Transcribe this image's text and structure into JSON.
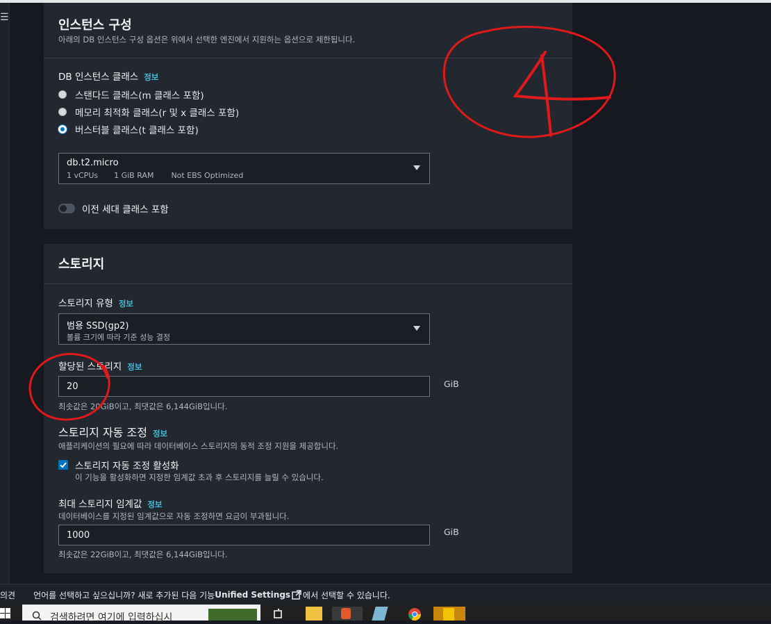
{
  "instance": {
    "title": "인스턴스 구성",
    "description": "아래의 DB 인스턴스 구성 옵션은 위에서 선택한 엔진에서 지원하는 옵션으로 제한됩니다.",
    "class_label": "DB 인스턴스 클래스",
    "info": "정보",
    "options": [
      {
        "label": "스탠다드 클래스(m 클래스 포함)",
        "checked": false
      },
      {
        "label": "메모리 최적화 클래스(r 및 x 클래스 포함)",
        "checked": false
      },
      {
        "label": "버스터블 클래스(t 클래스 포함)",
        "checked": true
      }
    ],
    "select": {
      "value": "db.t2.micro",
      "vcpu": "1 vCPUs",
      "ram": "1 GiB RAM",
      "ebs": "Not EBS Optimized"
    },
    "toggle_label": "이전 세대 클래스 포함"
  },
  "storage": {
    "title": "스토리지",
    "type_label": "스토리지 유형",
    "info": "정보",
    "type_value": "범용 SSD(gp2)",
    "type_desc": "볼륨 크기에 따라 기준 성능 결정",
    "alloc_label": "할당된 스토리지",
    "alloc_value": "20",
    "unit": "GiB",
    "alloc_hint": "최솟값은 20GiB이고, 최댓값은 6,144GiB입니다.",
    "autoscale_title": "스토리지 자동 조정",
    "autoscale_desc": "애플리케이션의 필요에 따라 데이터베이스 스토리지의 동적 조정 지원을 제공합니다.",
    "autoscale_check_label": "스토리지 자동 조정 활성화",
    "autoscale_check_desc": "이 기능을 활성화하면 지정한 임계값 초과 후 스토리지를 늘릴 수 있습니다.",
    "max_label": "최대 스토리지 임계값",
    "max_desc": "데이터베이스를 지정된 임계값으로 자동 조정하면 요금이 부과됩니다.",
    "max_value": "1000",
    "max_hint": "최솟값은 22GiB이고, 최댓값은 6,144GiB입니다."
  },
  "footer": {
    "feedback": "의견",
    "message_pre": "언어를 선택하고 싶으십니까? 새로 추가된 다음 기능",
    "link": "Unified Settings",
    "message_post": "에서 선택할 수 있습니다."
  },
  "taskbar": {
    "search_placeholder": "검색하려면 여기에 입력하십시"
  },
  "annotations": {
    "number": "4"
  },
  "colors": {
    "accent": "#0073bb",
    "info_link": "#44b9d6",
    "annotation": "#e0191b"
  }
}
